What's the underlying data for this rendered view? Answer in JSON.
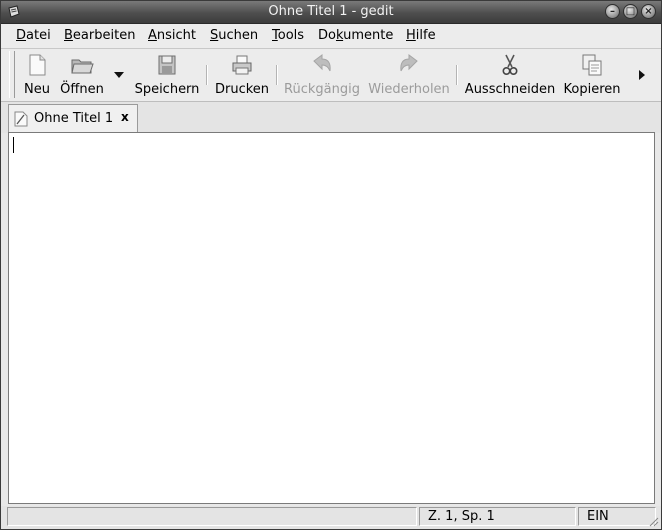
{
  "window": {
    "title": "Ohne Titel 1 - gedit"
  },
  "menubar": {
    "items": [
      {
        "label": "Datei",
        "mnemonic": "D",
        "rest": "atei"
      },
      {
        "label": "Bearbeiten",
        "mnemonic": "B",
        "rest": "earbeiten"
      },
      {
        "label": "Ansicht",
        "mnemonic": "A",
        "rest": "nsicht"
      },
      {
        "label": "Suchen",
        "mnemonic": "S",
        "rest": "uchen"
      },
      {
        "label": "Tools",
        "mnemonic": "T",
        "rest": "ools"
      },
      {
        "label": "Dokumente",
        "pre": "Do",
        "mnemonic": "k",
        "rest": "umente"
      },
      {
        "label": "Hilfe",
        "mnemonic": "H",
        "rest": "ilfe"
      }
    ]
  },
  "toolbar": {
    "new": {
      "label": "Neu",
      "icon": "new-document-icon"
    },
    "open": {
      "label": "Öffnen",
      "icon": "folder-icon"
    },
    "save": {
      "label": "Speichern",
      "icon": "floppy-icon"
    },
    "print": {
      "label": "Drucken",
      "icon": "printer-icon"
    },
    "undo": {
      "label": "Rückgängig",
      "icon": "undo-icon",
      "enabled": false
    },
    "redo": {
      "label": "Wiederholen",
      "icon": "redo-icon",
      "enabled": false
    },
    "cut": {
      "label": "Ausschneiden",
      "icon": "scissors-icon"
    },
    "copy": {
      "label": "Kopieren",
      "icon": "copy-icon"
    }
  },
  "tabs": [
    {
      "label": "Ohne Titel 1",
      "close": "x"
    }
  ],
  "editor": {
    "content": ""
  },
  "statusbar": {
    "position": "Z. 1, Sp. 1",
    "mode": "EIN"
  }
}
